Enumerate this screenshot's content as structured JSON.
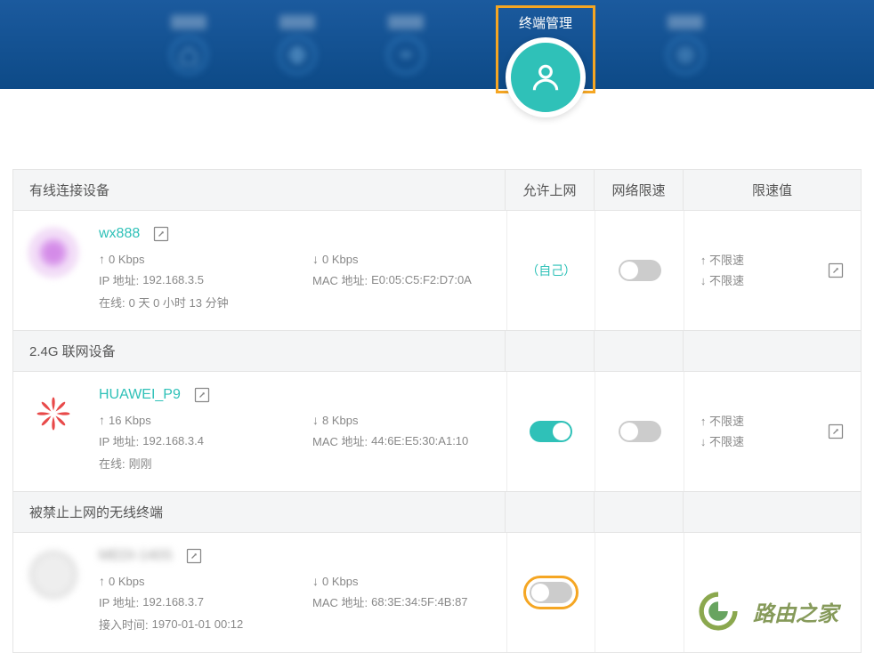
{
  "nav": {
    "active_label": "终端管理"
  },
  "headers": {
    "allow": "允许上网",
    "speed": "网络限速",
    "limit": "限速值"
  },
  "sections": [
    {
      "title": "有线连接设备"
    },
    {
      "title": "2.4G 联网设备"
    },
    {
      "title": "被禁止上网的无线终端"
    }
  ],
  "devices": [
    {
      "name": "wx888",
      "up": "0 Kbps",
      "down": "0 Kbps",
      "ip_label": "IP 地址:",
      "ip": "192.168.3.5",
      "mac_label": "MAC 地址:",
      "mac": "E0:05:C5:F2:D7:0A",
      "online_label": "在线:",
      "online": "0 天 0 小时 13 分钟",
      "self": "（自己）",
      "limit_up": "不限速",
      "limit_down": "不限速"
    },
    {
      "name": "HUAWEI_P9",
      "up": "16 Kbps",
      "down": "8 Kbps",
      "ip_label": "IP 地址:",
      "ip": "192.168.3.4",
      "mac_label": "MAC 地址:",
      "mac": "44:6E:E5:30:A1:10",
      "online_label": "在线:",
      "online": "刚刚",
      "limit_up": "不限速",
      "limit_down": "不限速"
    },
    {
      "name": "MEDI-140S",
      "up": "0 Kbps",
      "down": "0 Kbps",
      "ip_label": "IP 地址:",
      "ip": "192.168.3.7",
      "mac_label": "MAC 地址:",
      "mac": "68:3E:34:5F:4B:87",
      "time_label": "接入时间:",
      "time": "1970-01-01 00:12"
    }
  ],
  "watermark": "路由之家"
}
